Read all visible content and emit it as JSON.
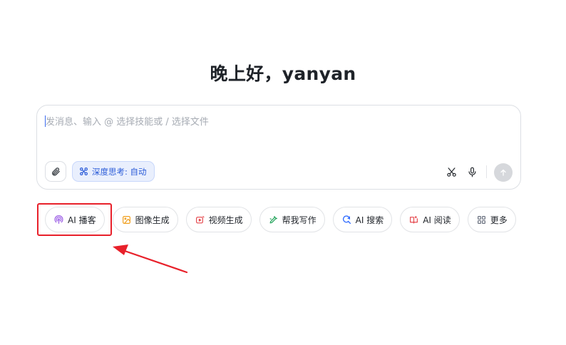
{
  "greeting": "晚上好，yanyan",
  "chat": {
    "placeholder": "发消息、输入 @ 选择技能或 / 选择文件",
    "value": "",
    "deep_think_label": "深度思考: 自动"
  },
  "chips": [
    {
      "label": "AI 播客",
      "icon": "podcast-icon",
      "color": "#9b5de5"
    },
    {
      "label": "图像生成",
      "icon": "image-icon",
      "color": "#f0a020"
    },
    {
      "label": "视频生成",
      "icon": "video-icon",
      "color": "#e5484d"
    },
    {
      "label": "帮我写作",
      "icon": "pen-icon",
      "color": "#22a35a"
    },
    {
      "label": "AI 搜索",
      "icon": "search-icon",
      "color": "#2f6bff"
    },
    {
      "label": "AI 阅读",
      "icon": "book-icon",
      "color": "#e5484d"
    },
    {
      "label": "更多",
      "icon": "grid-icon",
      "color": "#6b7280"
    }
  ],
  "colors": {
    "accent": "#2b5cd8",
    "highlight": "#e8202a"
  }
}
